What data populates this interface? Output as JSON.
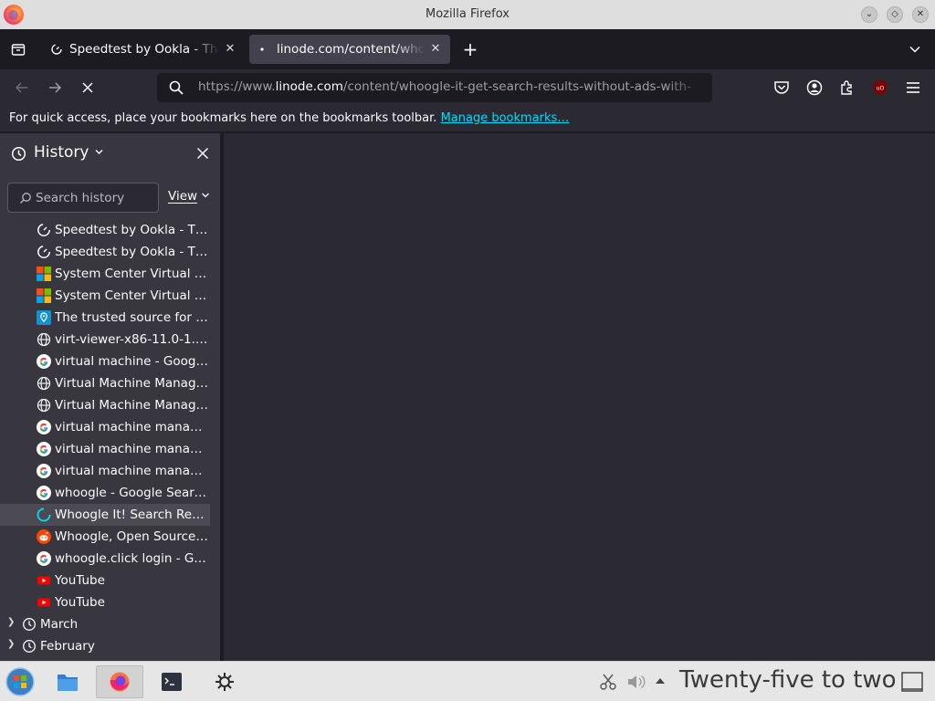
{
  "window": {
    "title": "Mozilla Firefox"
  },
  "tabs": [
    {
      "label": "Speedtest by Ookla - The Global Broadband Speed Test",
      "active": false
    },
    {
      "label": "linode.com/content/whoogle-it-get-search-results-without-ads-with-",
      "active": true
    }
  ],
  "urlbar": {
    "prefix": "https://www.",
    "domain": "linode.com",
    "path": "/content/whoogle-it-get-search-results-without-ads-with-"
  },
  "bookmarks_bar": {
    "message": "For quick access, place your bookmarks here on the bookmarks toolbar.",
    "link": "Manage bookmarks…"
  },
  "sidebar": {
    "title": "History",
    "search_placeholder": "Search history",
    "view_label": "View",
    "items": [
      {
        "label": "Speedtest by Ookla - Th...",
        "icon": "speedtest-icon"
      },
      {
        "label": "Speedtest by Ookla - Th...",
        "icon": "speedtest-icon"
      },
      {
        "label": "System Center Virtual M...",
        "icon": "microsoft-icon"
      },
      {
        "label": "System Center Virtual M...",
        "icon": "microsoft-icon"
      },
      {
        "label": "The trusted source for IP...",
        "icon": "location-pin-icon"
      },
      {
        "label": "virt-viewer-x86-11.0-1.0...",
        "icon": "globe-icon"
      },
      {
        "label": "virtual machine - Google...",
        "icon": "google-icon"
      },
      {
        "label": "Virtual Machine Manage...",
        "icon": "globe-icon"
      },
      {
        "label": "Virtual Machine Manage...",
        "icon": "globe-icon"
      },
      {
        "label": "virtual machine manage...",
        "icon": "google-icon"
      },
      {
        "label": "virtual machine manage...",
        "icon": "google-icon"
      },
      {
        "label": "virtual machine manage...",
        "icon": "google-icon"
      },
      {
        "label": "whoogle - Google Searc...",
        "icon": "google-icon"
      },
      {
        "label": "Whoogle It! Search Resu...",
        "icon": "loading-icon",
        "selected": true
      },
      {
        "label": "Whoogle, Open Source ...",
        "icon": "reddit-icon"
      },
      {
        "label": "whoogle.click login - Go...",
        "icon": "google-icon"
      },
      {
        "label": "YouTube",
        "icon": "youtube-icon"
      },
      {
        "label": "YouTube",
        "icon": "youtube-icon"
      }
    ],
    "groups": [
      {
        "label": "March"
      },
      {
        "label": "February"
      }
    ]
  },
  "taskbar": {
    "clock": "Twenty-five to two"
  },
  "colors": {
    "accent_link": "#00ddff",
    "sidebar_bg": "#38373f",
    "content_bg": "#2b2a33"
  }
}
